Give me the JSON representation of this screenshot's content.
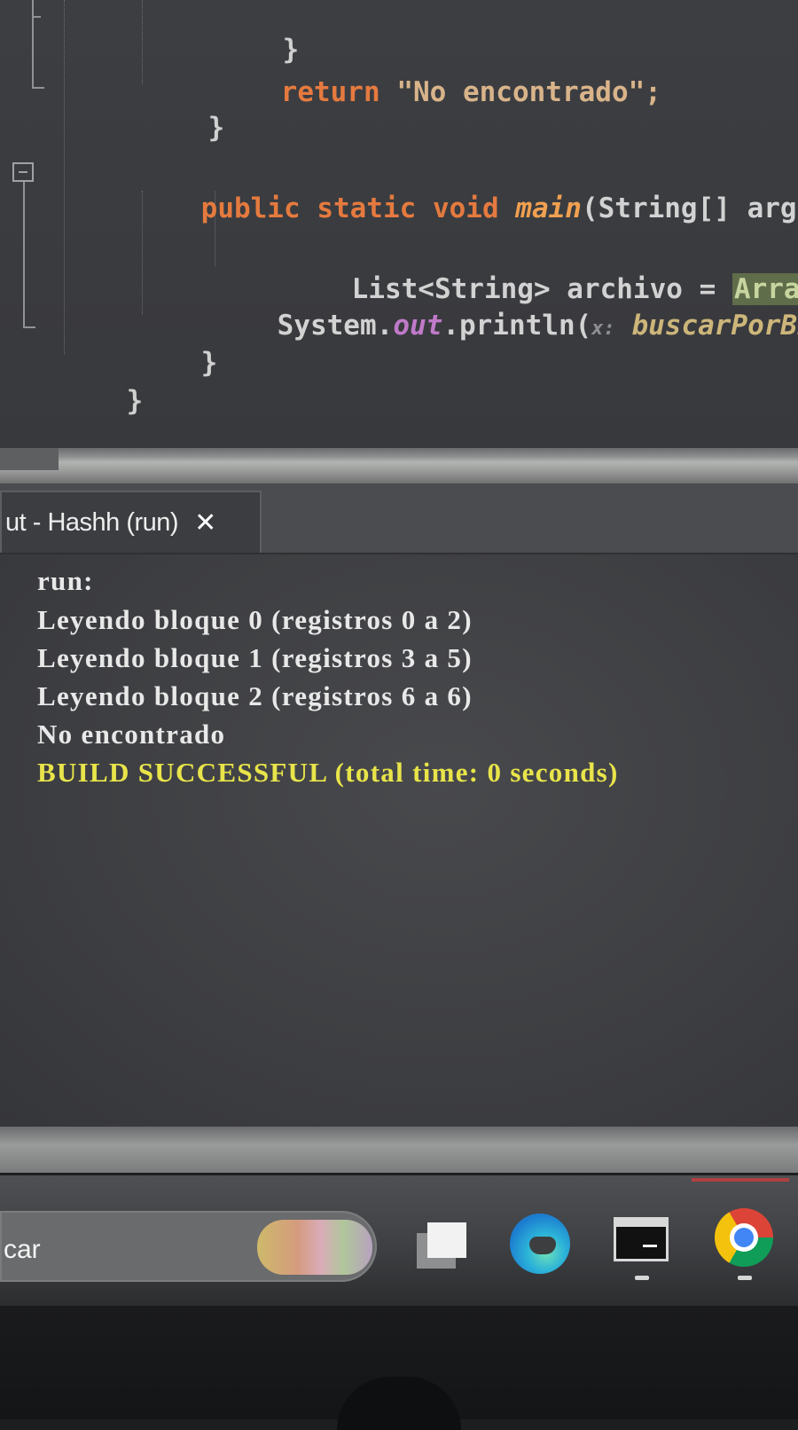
{
  "editor": {
    "lines": {
      "l1_brace": "}",
      "l2_return_kw": "return",
      "l2_return_str": "\"No encontrado\";",
      "l3_brace": "}",
      "l4_public": "public",
      "l4_static": "static",
      "l4_void": "void",
      "l4_main": "main",
      "l4_sig": "(String[] arg",
      "l5_decl": "List<String> archivo = ",
      "l5_array": "Array",
      "l6_system": "System.",
      "l6_out": "out",
      "l6_println": ".println(",
      "l6_hint": "x:",
      "l6_call": " buscarPorBi",
      "l7_brace": "}",
      "l8_brace": "}"
    }
  },
  "output_tab": {
    "label": "ut - Hashh (run)",
    "close_glyph": "✕"
  },
  "output": {
    "lines": [
      "run:",
      "Leyendo bloque 0 (registros 0 a 2)",
      "Leyendo bloque 1 (registros 3 a 5)",
      "Leyendo bloque 2 (registros 6 a 6)",
      "No encontrado",
      "BUILD SUCCESSFUL (total time: 0 seconds)"
    ]
  },
  "taskbar": {
    "search_text": "car",
    "icons": [
      "task-view-icon",
      "edge-icon",
      "terminal-icon",
      "chrome-icon"
    ]
  },
  "colors": {
    "keyword": "#e57a3f",
    "success": "#e8e44a"
  }
}
